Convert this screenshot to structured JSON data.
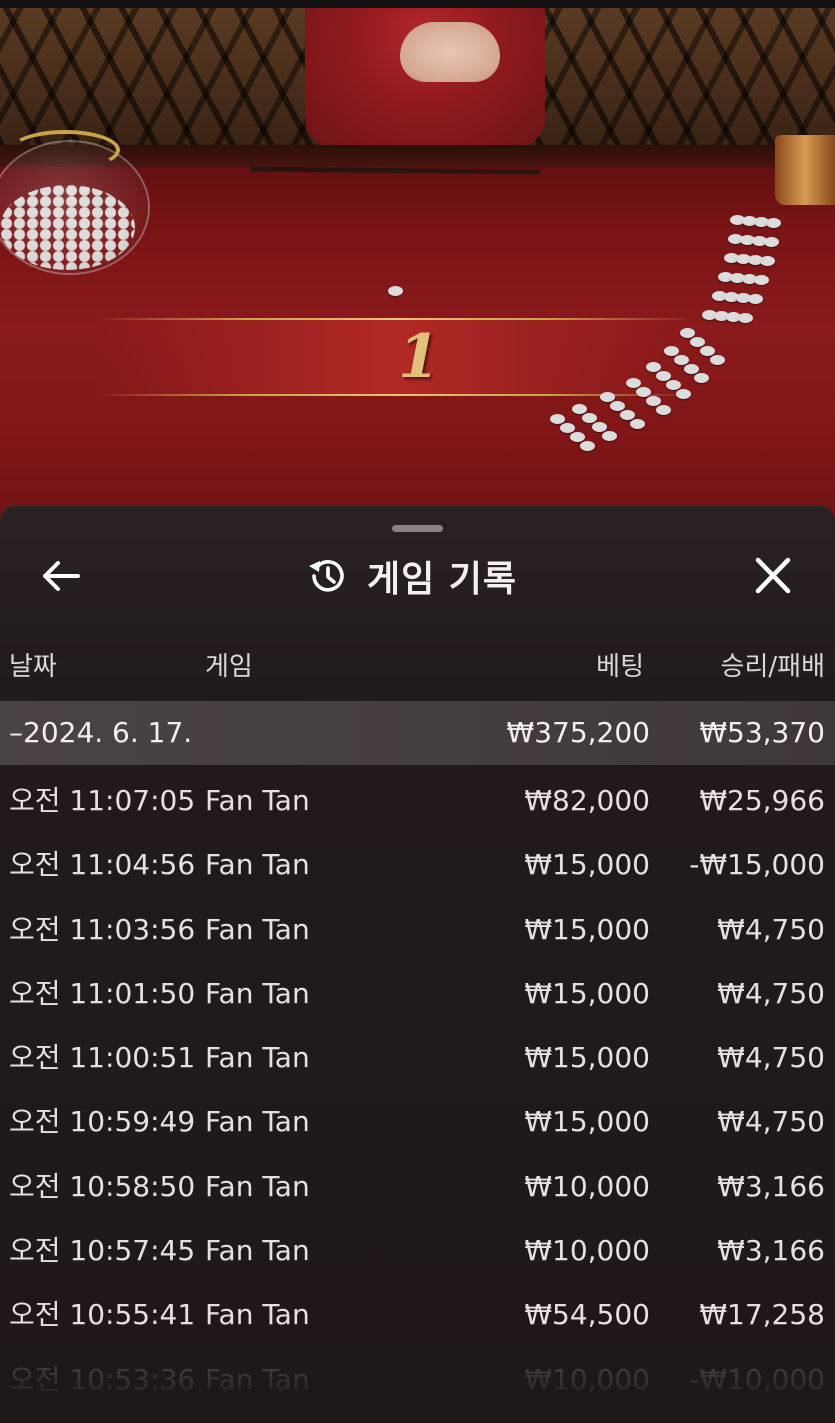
{
  "header": {
    "title": "게임 기록",
    "back_icon": "arrow-left-icon",
    "history_icon": "history-clock-icon",
    "close_icon": "close-icon"
  },
  "scene": {
    "result_number": "1"
  },
  "columns": {
    "date": "날짜",
    "game": "게임",
    "bet": "베팅",
    "win_loss": "승리/패배"
  },
  "group": {
    "date": "–2024. 6. 17.",
    "bet": "₩375,200",
    "win_loss": "₩53,370"
  },
  "rows": [
    {
      "time": "오전 11:07:05",
      "game": "Fan Tan",
      "bet": "₩82,000",
      "win_loss": "₩25,966"
    },
    {
      "time": "오전 11:04:56",
      "game": "Fan Tan",
      "bet": "₩15,000",
      "win_loss": "-₩15,000"
    },
    {
      "time": "오전 11:03:56",
      "game": "Fan Tan",
      "bet": "₩15,000",
      "win_loss": "₩4,750"
    },
    {
      "time": "오전 11:01:50",
      "game": "Fan Tan",
      "bet": "₩15,000",
      "win_loss": "₩4,750"
    },
    {
      "time": "오전 11:00:51",
      "game": "Fan Tan",
      "bet": "₩15,000",
      "win_loss": "₩4,750"
    },
    {
      "time": "오전 10:59:49",
      "game": "Fan Tan",
      "bet": "₩15,000",
      "win_loss": "₩4,750"
    },
    {
      "time": "오전 10:58:50",
      "game": "Fan Tan",
      "bet": "₩10,000",
      "win_loss": "₩3,166"
    },
    {
      "time": "오전 10:57:45",
      "game": "Fan Tan",
      "bet": "₩10,000",
      "win_loss": "₩3,166"
    },
    {
      "time": "오전 10:55:41",
      "game": "Fan Tan",
      "bet": "₩54,500",
      "win_loss": "₩17,258"
    },
    {
      "time": "오전 10:53:36",
      "game": "Fan Tan",
      "bet": "₩10,000",
      "win_loss": "-₩10,000"
    }
  ],
  "colors": {
    "sheet_bg": "#221b1b",
    "group_row_bg": "#4a4343",
    "table_felt": "#8a1a1b",
    "gold_accent": "#c9a24a"
  }
}
